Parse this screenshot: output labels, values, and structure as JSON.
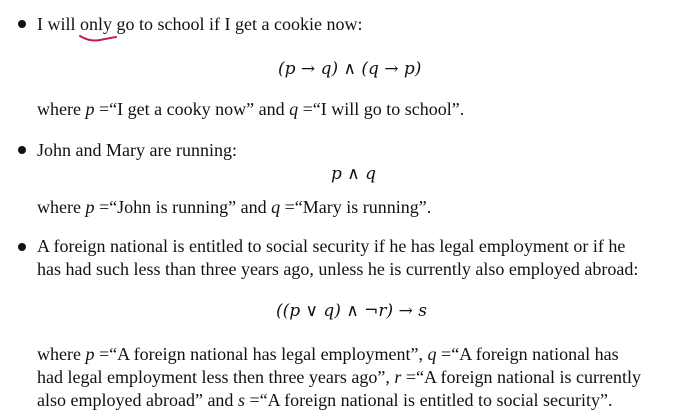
{
  "item1": {
    "prefix": "I will ",
    "underlined": "only",
    "suffix": " go to school if I get a cookie now:",
    "formula": "(p → q) ∧ (q → p)",
    "where_p_lead": "where ",
    "var_p": "p",
    "p_def": " =“I get a cooky now” and ",
    "var_q": "q",
    "q_def": " =“I will go to school”."
  },
  "item2": {
    "text": "John and Mary are running:",
    "formula": "p ∧ q",
    "where_lead": "where ",
    "var_p": "p",
    "p_def": " =“John is running” and ",
    "var_q": "q",
    "q_def": " =“Mary is running”."
  },
  "item3": {
    "line1": "A foreign national is entitled to social security if he has legal employment or if he",
    "line2": "has had such less than three years ago, unless he is currently also employed abroad:",
    "formula": "((p ∨ q) ∧ ¬r) → s",
    "where_line1_lead": "where ",
    "var_p": "p",
    "p_def": " =“A foreign national has legal employment”, ",
    "var_q": "q",
    "q_def_a": " =“A foreign national has",
    "where_line2_a": "had legal employment less then three years ago”, ",
    "var_r": "r",
    "r_def": " =“A foreign national is currently",
    "where_line3_a": "also employed abroad” and ",
    "var_s": "s",
    "s_def": " =“A foreign national is entitled to social security”."
  },
  "colors": {
    "text": "#111111",
    "underline_annotation": "#c2185b"
  }
}
